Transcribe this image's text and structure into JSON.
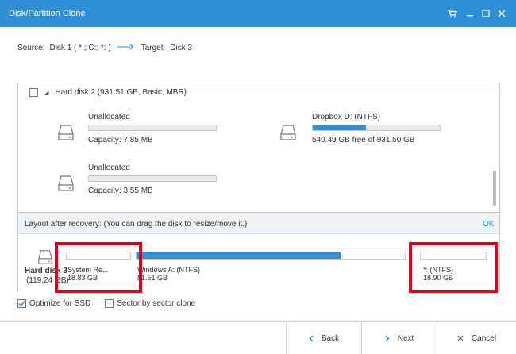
{
  "window": {
    "title": "Disk/Partition Clone",
    "controls": [
      "cart-icon",
      "minimize-icon",
      "maximize-icon",
      "close-icon"
    ]
  },
  "source_line": {
    "source_label": "Source:",
    "source_value": "Disk 1 ( *:; C:; *: )",
    "target_label": "Target:",
    "target_value": "Disk 3"
  },
  "disk2": {
    "header": "Hard disk 2 (931.51 GB, Basic, MBR)",
    "partitions": [
      {
        "name": "Unallocated",
        "info": "Capacity: 7.85 MB",
        "used_fraction": 0
      },
      {
        "name": "Dropbox D: (NTFS)",
        "info": "540.49 GB free of 931.50 GB",
        "used_fraction": 0.42
      },
      {
        "name": "Unallocated",
        "info": "Capacity: 3.55 MB",
        "used_fraction": 0
      }
    ]
  },
  "layout": {
    "header": "Layout after recovery: (You can drag the disk to resize/move it.)",
    "ok_label": "OK",
    "disk_label": "Hard disk 3",
    "disk_size": "(119.24 GB)",
    "segments": [
      {
        "name": "System Re...",
        "size": "18.83 GB",
        "used_fraction": 0
      },
      {
        "name": "Windows A: (NTFS)",
        "size": "81.51 GB",
        "used_fraction": 0.75
      },
      {
        "name": "*: (NTFS)",
        "size": "18.90 GB",
        "used_fraction": 0
      }
    ]
  },
  "options": {
    "optimize_ssd": {
      "label": "Optimize for SSD",
      "checked": true
    },
    "sector_clone": {
      "label": "Sector by sector clone",
      "checked": false
    }
  },
  "footer": {
    "back_label": "Back",
    "next_label": "Next",
    "cancel_label": "Cancel"
  },
  "colors": {
    "accent": "#2f8fd6",
    "highlight": "#e3001b"
  }
}
